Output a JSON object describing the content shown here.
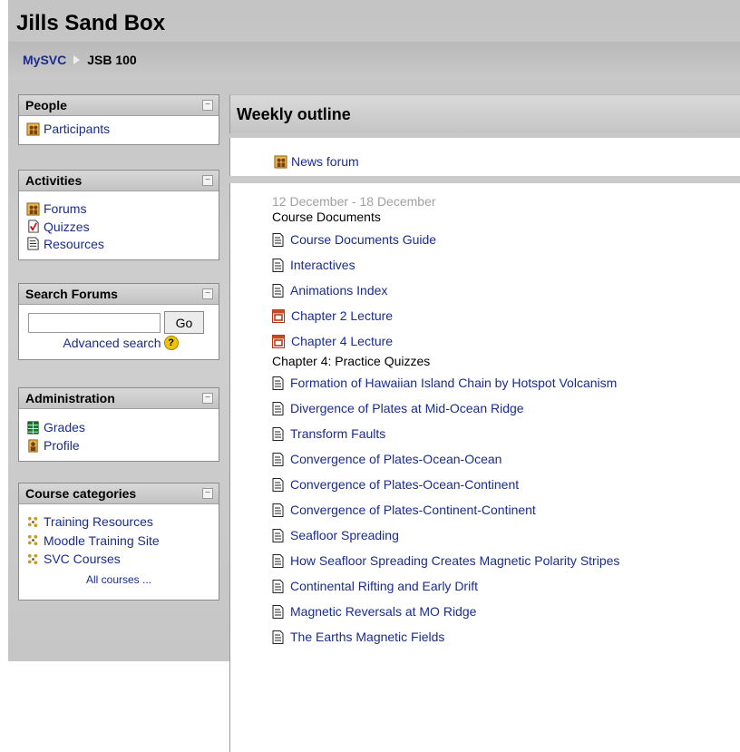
{
  "site_title": "Jills Sand Box",
  "breadcrumb": {
    "home": "MySVC",
    "current": "JSB 100"
  },
  "blocks": {
    "people": {
      "title": "People",
      "items": [
        {
          "label": "Participants",
          "icon": "people-icon"
        }
      ]
    },
    "activities": {
      "title": "Activities",
      "items": [
        {
          "label": "Forums",
          "icon": "forum-icon"
        },
        {
          "label": "Quizzes",
          "icon": "quiz-icon"
        },
        {
          "label": "Resources",
          "icon": "resource-icon"
        }
      ]
    },
    "search": {
      "title": "Search Forums",
      "query": "",
      "go_label": "Go",
      "advanced_label": "Advanced search",
      "help_glyph": "?"
    },
    "administration": {
      "title": "Administration",
      "items": [
        {
          "label": "Grades",
          "icon": "grades-icon"
        },
        {
          "label": "Profile",
          "icon": "profile-icon"
        }
      ]
    },
    "categories": {
      "title": "Course categories",
      "items": [
        {
          "label": "Training Resources",
          "icon": "category-icon"
        },
        {
          "label": "Moodle Training Site",
          "icon": "category-icon"
        },
        {
          "label": "SVC Courses",
          "icon": "category-icon"
        }
      ],
      "all_courses": "All courses ..."
    },
    "collapse_glyph": "−"
  },
  "main": {
    "title": "Weekly outline",
    "news_forum": "News forum",
    "week": {
      "date_range": "12 December - 18 December",
      "label1": "Course Documents",
      "group1": [
        {
          "label": "Course Documents Guide",
          "icon": "document-icon"
        },
        {
          "label": "Interactives",
          "icon": "document-icon"
        },
        {
          "label": "Animations Index",
          "icon": "document-icon"
        },
        {
          "label": "Chapter 2 Lecture",
          "icon": "pdf-icon"
        },
        {
          "label": "Chapter 4 Lecture",
          "icon": "pdf-icon"
        }
      ],
      "label2": "Chapter 4: Practice Quizzes",
      "group2": [
        {
          "label": "Formation of Hawaiian Island Chain by Hotspot Volcanism",
          "icon": "document-icon"
        },
        {
          "label": "Divergence of Plates at Mid-Ocean Ridge",
          "icon": "document-icon"
        },
        {
          "label": "Transform Faults",
          "icon": "document-icon"
        },
        {
          "label": "Convergence of Plates-Ocean-Ocean",
          "icon": "document-icon"
        },
        {
          "label": "Convergence of Plates-Ocean-Continent",
          "icon": "document-icon"
        },
        {
          "label": "Convergence of Plates-Continent-Continent",
          "icon": "document-icon"
        },
        {
          "label": "Seafloor Spreading",
          "icon": "document-icon"
        },
        {
          "label": "How Seafloor Spreading Creates Magnetic Polarity Stripes",
          "icon": "document-icon"
        },
        {
          "label": "Continental Rifting and Early Drift",
          "icon": "document-icon"
        },
        {
          "label": "Magnetic Reversals at MO Ridge",
          "icon": "document-icon"
        },
        {
          "label": "The Earths Magnetic Fields",
          "icon": "document-icon"
        }
      ]
    }
  },
  "colors": {
    "link": "#1a2c8e",
    "date": "#a0a0a0",
    "background": "#c8c8c8"
  }
}
